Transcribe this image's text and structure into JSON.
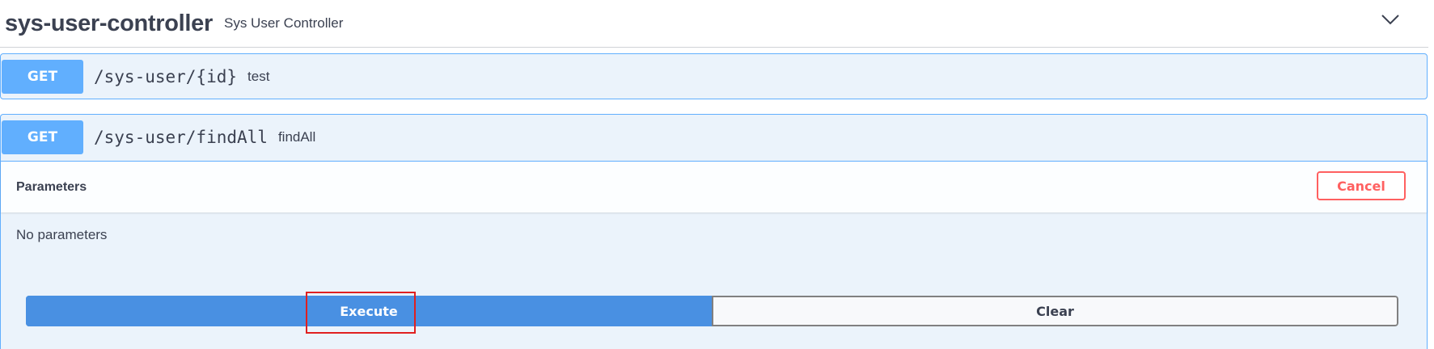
{
  "tag": {
    "name": "sys-user-controller",
    "description": "Sys User Controller",
    "toggle_icon": "chevron-down-icon"
  },
  "operations": [
    {
      "method": "GET",
      "path": "/sys-user/{id}",
      "summary": "test",
      "expanded": false
    },
    {
      "method": "GET",
      "path": "/sys-user/findAll",
      "summary": "findAll",
      "expanded": true
    }
  ],
  "parameters": {
    "title": "Parameters",
    "cancel_label": "Cancel",
    "empty_text": "No parameters"
  },
  "actions": {
    "execute_label": "Execute",
    "clear_label": "Clear"
  },
  "colors": {
    "get_accent": "#61affe",
    "opblock_bg": "#ebf3fb",
    "execute_bg": "#4990e2",
    "cancel": "#ff6060",
    "highlight": "#e02020"
  }
}
